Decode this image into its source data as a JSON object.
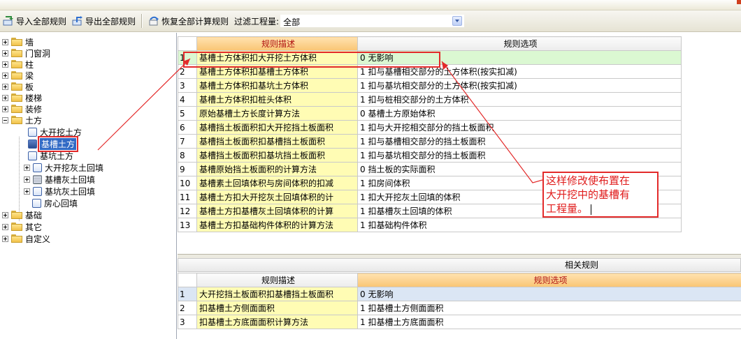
{
  "toolbar": {
    "import_label": "导入全部规则",
    "export_label": "导出全部规则",
    "restore_label": "恢复全部计算规则",
    "filter_label": "过滤工程量:",
    "filter_value": "全部"
  },
  "tree": {
    "wall": "墙",
    "door_window": "门窗洞",
    "column": "柱",
    "beam": "梁",
    "slab": "板",
    "stair": "楼梯",
    "decoration": "装修",
    "earthwork": "土方",
    "earthwork_children": {
      "big_excavation": "大开挖土方",
      "trench": "基槽土方",
      "pit": "基坑土方",
      "big_excavation_backfill": "大开挖灰土回填",
      "trench_backfill": "基槽灰土回填",
      "pit_backfill": "基坑灰土回填",
      "room_backfill": "房心回填"
    },
    "foundation": "基础",
    "other": "其它",
    "custom": "自定义"
  },
  "rules": {
    "header_desc": "规则描述",
    "header_option": "规则选项",
    "rows": [
      {
        "no": "1",
        "desc": "基槽土方体积扣大开挖土方体积",
        "option": "0  无影响"
      },
      {
        "no": "2",
        "desc": "基槽土方体积扣基槽土方体积",
        "option": "1  扣与基槽相交部分的土方体积(按实扣减)"
      },
      {
        "no": "3",
        "desc": "基槽土方体积扣基坑土方体积",
        "option": "1  扣与基坑相交部分的土方体积(按实扣减)"
      },
      {
        "no": "4",
        "desc": "基槽土方体积扣桩头体积",
        "option": "1  扣与桩相交部分的土方体积"
      },
      {
        "no": "5",
        "desc": "原始基槽土方长度计算方法",
        "option": "0 基槽土方原始体积"
      },
      {
        "no": "6",
        "desc": "基槽挡土板面积扣大开挖挡土板面积",
        "option": "1  扣与大开挖相交部分的挡土板面积"
      },
      {
        "no": "7",
        "desc": "基槽挡土板面积扣基槽挡土板面积",
        "option": "1  扣与基槽相交部分的挡土板面积"
      },
      {
        "no": "8",
        "desc": "基槽挡土板面积扣基坑挡土板面积",
        "option": "1  扣与基坑相交部分的挡土板面积"
      },
      {
        "no": "9",
        "desc": "基槽原始挡土板面积的计算方法",
        "option": "0  挡土板的实际面积"
      },
      {
        "no": "10",
        "desc": "基槽素土回填体积与房间体积的扣减",
        "option": "1  扣房间体积"
      },
      {
        "no": "11",
        "desc": "基槽土方扣大开挖灰土回填体积的计",
        "option": "1 扣大开挖灰土回填的体积"
      },
      {
        "no": "12",
        "desc": "基槽土方扣基槽灰土回填体积的计算",
        "option": "1 扣基槽灰土回填的体积"
      },
      {
        "no": "13",
        "desc": "基槽土方扣基础构件体积的计算方法",
        "option": "1 扣基础构件体积"
      }
    ]
  },
  "related": {
    "title": "相关规则",
    "header_desc": "规则描述",
    "header_option": "规则选项",
    "rows": [
      {
        "no": "1",
        "desc": "大开挖挡土板面积扣基槽挡土板面积",
        "option": "0  无影响"
      },
      {
        "no": "2",
        "desc": "扣基槽土方侧面面积",
        "option": "1 扣基槽土方侧面面积"
      },
      {
        "no": "3",
        "desc": "扣基槽土方底面面积计算方法",
        "option": "1 扣基槽土方底面面积"
      }
    ]
  },
  "annotation": {
    "line1": "这样修改使布置在",
    "line2": "大开挖中的基槽有",
    "line3": "工程量。"
  },
  "colors": {
    "annotation_red": "#e32a2a",
    "desc_cell": "#fffcb4",
    "selected_row": "#dbf8d2",
    "header_orange": "#f9c574",
    "tree_selection": "#316ac5"
  }
}
